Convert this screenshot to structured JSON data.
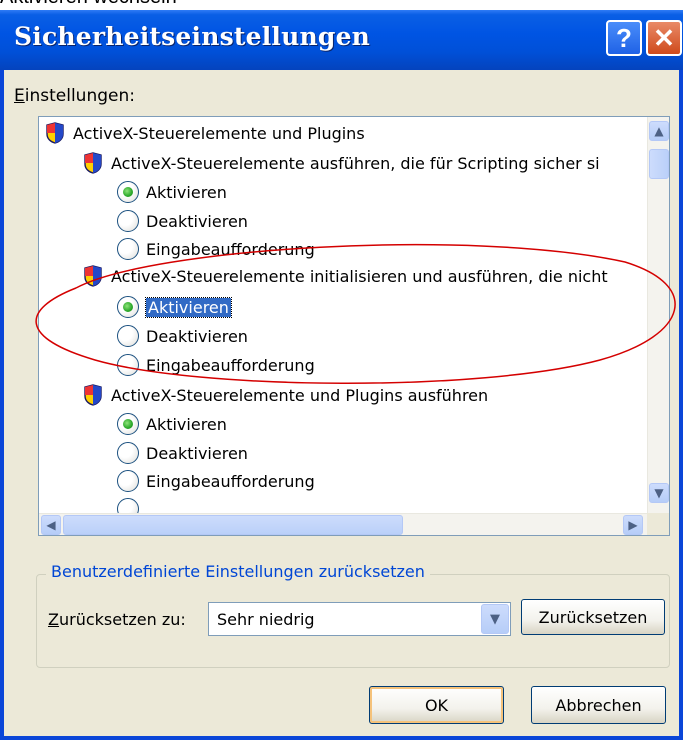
{
  "caption": "Aktivieren wechseln",
  "window": {
    "title": "Sicherheitseinstellungen",
    "help_glyph": "?",
    "close_glyph": "✕"
  },
  "settings_label": "Einstellungen:",
  "tree": {
    "root": "ActiveX-Steuerelemente und Plugins",
    "group1": {
      "label": "ActiveX-Steuerelemente ausführen, die für Scripting sicher si",
      "options": [
        "Aktivieren",
        "Deaktivieren",
        "Eingabeaufforderung"
      ],
      "selected": "Aktivieren"
    },
    "group2": {
      "label": "ActiveX-Steuerelemente initialisieren und ausführen, die nicht",
      "options": [
        "Aktivieren",
        "Deaktivieren",
        "Eingabeaufforderung"
      ],
      "selected": "Aktivieren"
    },
    "group3": {
      "label": "ActiveX-Steuerelemente und Plugins ausführen",
      "options": [
        "Aktivieren",
        "Deaktivieren",
        "Eingabeaufforderung"
      ],
      "selected": "Aktivieren"
    }
  },
  "custom_reset": {
    "legend": "Benutzerdefinierte Einstellungen zurücksetzen",
    "reset_to_label": "Zurücksetzen zu:",
    "reset_to_value": "Sehr niedrig",
    "reset_button": "Zurücksetzen"
  },
  "buttons": {
    "ok": "OK",
    "cancel": "Abbrechen"
  },
  "colors": {
    "titlebar": "#0054e3",
    "annotation": "#d40000",
    "selection": "#316ac5"
  }
}
